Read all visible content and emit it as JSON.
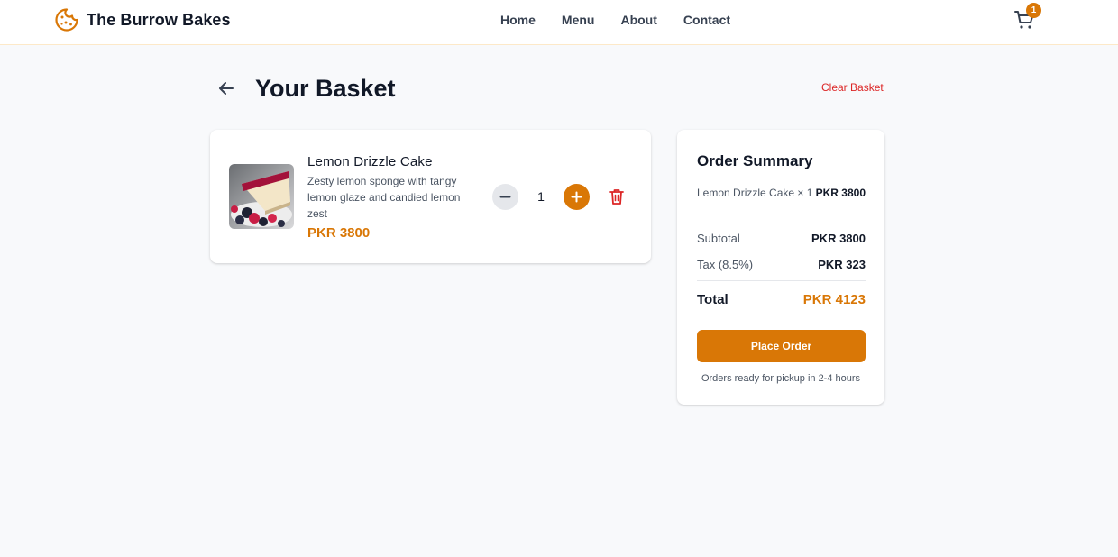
{
  "brand": {
    "name": "The Burrow Bakes",
    "logo_icon": "cookie-icon",
    "accent": "#d97706"
  },
  "nav": {
    "items": [
      "Home",
      "Menu",
      "About",
      "Contact"
    ]
  },
  "cart": {
    "icon": "cart-icon",
    "badge": "1"
  },
  "page": {
    "title": "Your Basket",
    "back_icon": "arrow-left-icon",
    "clear_label": "Clear Basket"
  },
  "basket": {
    "items": [
      {
        "name": "Lemon Drizzle Cake",
        "description": "Zesty lemon sponge with tangy lemon glaze and candied lemon zest",
        "price": "PKR 3800",
        "quantity": "1",
        "image_icon": "cake-slice-image"
      }
    ]
  },
  "summary": {
    "title": "Order Summary",
    "lines": [
      {
        "label": "Lemon Drizzle Cake × 1",
        "price": "PKR 3800"
      }
    ],
    "subtotal_label": "Subtotal",
    "subtotal_value": "PKR 3800",
    "tax_label": "Tax (8.5%)",
    "tax_value": "PKR 323",
    "total_label": "Total",
    "total_value": "PKR 4123",
    "place_order_label": "Place Order",
    "pickup_note": "Orders ready for pickup in 2-4 hours"
  }
}
